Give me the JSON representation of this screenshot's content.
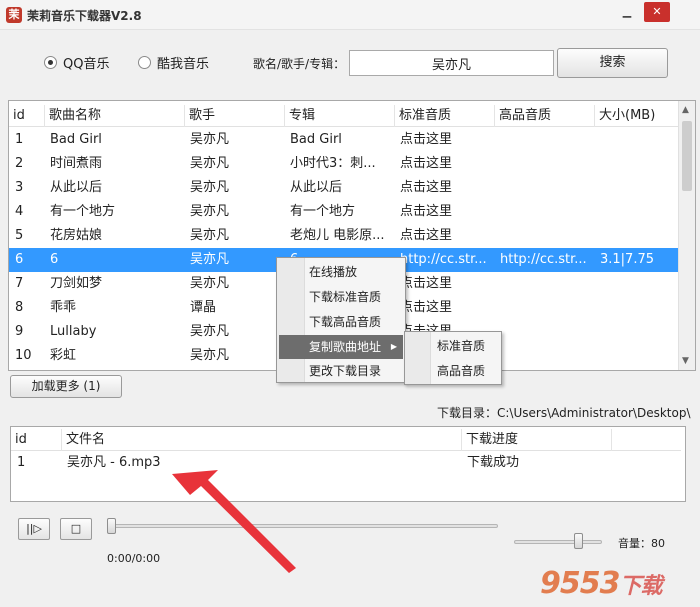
{
  "app": {
    "title": "茉莉音乐下载器V2.8",
    "icon": "jasmine-logo-icon"
  },
  "window_controls": {
    "minimize": "▁",
    "close": "✕"
  },
  "search": {
    "source_options": [
      {
        "label": "QQ音乐",
        "selected": true
      },
      {
        "label": "酷我音乐",
        "selected": false
      }
    ],
    "field_label": "歌名/歌手/专辑：",
    "query": "吴亦凡",
    "button_label": "搜索"
  },
  "song_table": {
    "columns": [
      "id",
      "歌曲名称",
      "歌手",
      "专辑",
      "标准音质",
      "高品音质",
      "大小(MB)"
    ],
    "rows": [
      {
        "id": "1",
        "name": "Bad Girl",
        "artist": "吴亦凡",
        "album": "Bad Girl",
        "std": "点击这里",
        "hq": "",
        "size": ""
      },
      {
        "id": "2",
        "name": "时间煮雨",
        "artist": "吴亦凡",
        "album": "小时代3：刺...",
        "std": "点击这里",
        "hq": "",
        "size": ""
      },
      {
        "id": "3",
        "name": "从此以后",
        "artist": "吴亦凡",
        "album": "从此以后",
        "std": "点击这里",
        "hq": "",
        "size": ""
      },
      {
        "id": "4",
        "name": "有一个地方",
        "artist": "吴亦凡",
        "album": "有一个地方",
        "std": "点击这里",
        "hq": "",
        "size": ""
      },
      {
        "id": "5",
        "name": "花房姑娘",
        "artist": "吴亦凡",
        "album": "老炮儿 电影原...",
        "std": "点击这里",
        "hq": "",
        "size": ""
      },
      {
        "id": "6",
        "name": "6",
        "artist": "吴亦凡",
        "album": "6",
        "std": "http://cc.str...",
        "hq": "http://cc.str...",
        "size": "3.1|7.75"
      },
      {
        "id": "7",
        "name": "刀剑如梦",
        "artist": "吴亦凡",
        "album": "",
        "std": "点击这里",
        "hq": "",
        "size": ""
      },
      {
        "id": "8",
        "name": "乖乖",
        "artist": "谭晶",
        "album": "",
        "std": "点击这里",
        "hq": "",
        "size": ""
      },
      {
        "id": "9",
        "name": "Lullaby",
        "artist": "吴亦凡",
        "album": "",
        "std": "点击这里",
        "hq": "",
        "size": ""
      },
      {
        "id": "10",
        "name": "彩虹",
        "artist": "吴亦凡",
        "album": "",
        "std": "",
        "hq": "",
        "size": ""
      }
    ],
    "selected_index": 5
  },
  "context_menu": {
    "items": [
      "在线播放",
      "下载标准音质",
      "下载高品音质",
      "复制歌曲地址",
      "更改下载目录"
    ],
    "active_index": 3,
    "submenu": [
      "标准音质",
      "高品音质"
    ]
  },
  "load_more": {
    "label": "加载更多 (1)"
  },
  "download_dir": {
    "label": "下载目录：C:\\Users\\Administrator\\Desktop\\"
  },
  "download_table": {
    "columns": [
      "id",
      "文件名",
      "下载进度"
    ],
    "rows": [
      {
        "id": "1",
        "file": "吴亦凡 - 6.mp3",
        "progress": "下载成功"
      }
    ]
  },
  "player": {
    "play_pause": "||▷",
    "stop": "□",
    "time": "0:00/0:00",
    "progress_fraction": 0,
    "volume_label": "音量：80",
    "volume": 80
  },
  "annotation": {
    "color": "#e8333a"
  },
  "watermark": {
    "text": "9553",
    "suffix": "下载"
  }
}
